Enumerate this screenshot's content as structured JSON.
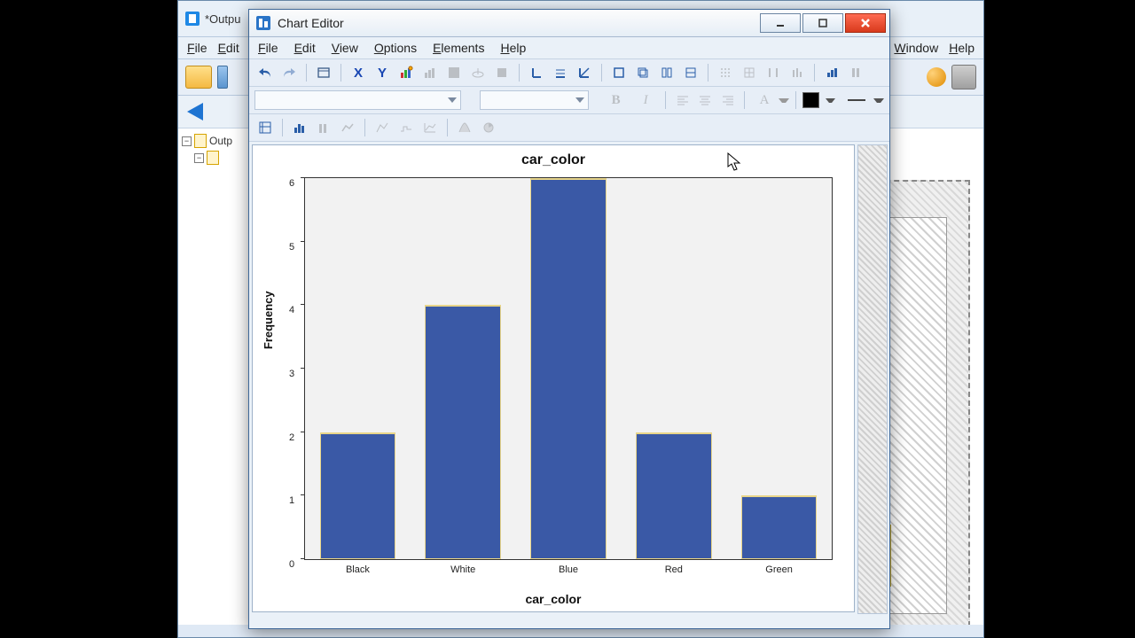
{
  "bg_window": {
    "title_prefix": "*Outpu",
    "menu": {
      "file": "File",
      "edit": "Edit",
      "window": "Window",
      "help": "Help"
    },
    "tree_root": "Outp"
  },
  "editor": {
    "title": "Chart Editor",
    "menu": {
      "file": "File",
      "edit": "Edit",
      "view": "View",
      "options": "Options",
      "elements": "Elements",
      "help": "Help"
    },
    "font_bold": "B",
    "font_italic": "I",
    "font_A": "A"
  },
  "chart_data": {
    "type": "bar",
    "title": "car_color",
    "xlabel": "car_color",
    "ylabel": "Frequency",
    "categories": [
      "Black",
      "White",
      "Blue",
      "Red",
      "Green"
    ],
    "values": [
      2,
      4,
      6,
      2,
      1
    ],
    "ylim": [
      0,
      6
    ],
    "yticks": [
      0,
      1,
      2,
      3,
      4,
      5,
      6
    ],
    "bar_color": "#3a59a6"
  }
}
